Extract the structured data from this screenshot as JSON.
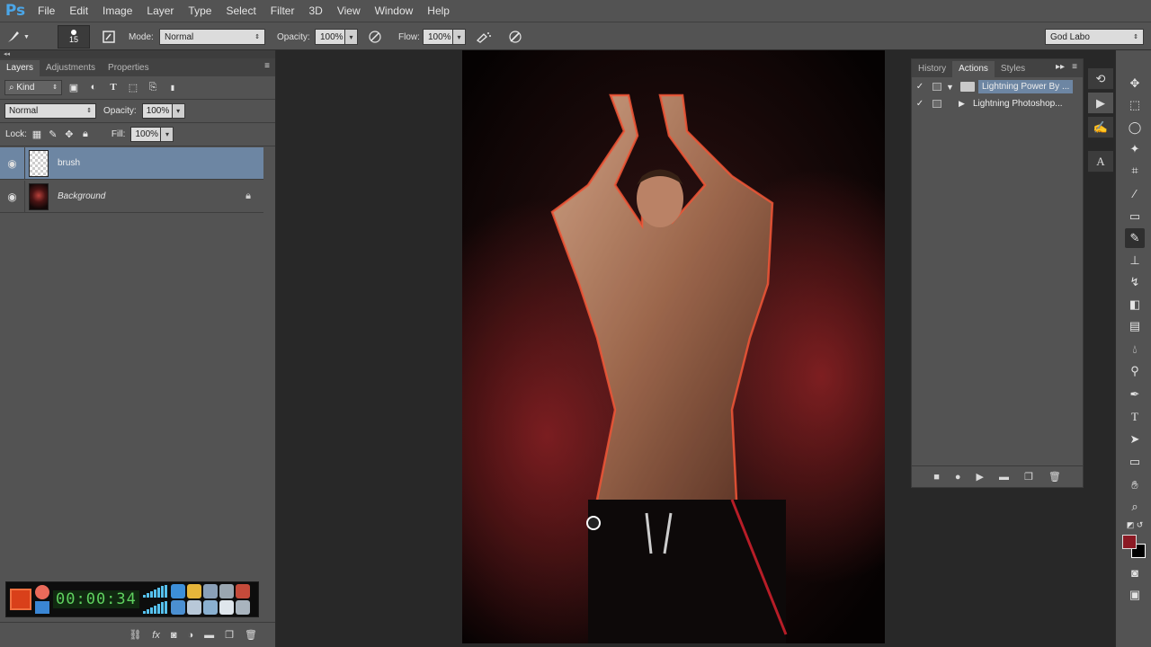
{
  "app": {
    "logo": "Ps",
    "menu": [
      "File",
      "Edit",
      "Image",
      "Layer",
      "Type",
      "Select",
      "Filter",
      "3D",
      "View",
      "Window",
      "Help"
    ]
  },
  "options_bar": {
    "brush_size": "15",
    "mode_label": "Mode:",
    "mode_value": "Normal",
    "opacity_label": "Opacity:",
    "opacity_value": "100%",
    "flow_label": "Flow:",
    "flow_value": "100%",
    "workspace": "God Labo"
  },
  "layers_panel": {
    "tabs": [
      "Layers",
      "Adjustments",
      "Properties"
    ],
    "filter_kind": "Kind",
    "blend_mode": "Normal",
    "opacity_label": "Opacity:",
    "opacity_value": "100%",
    "lock_label": "Lock:",
    "fill_label": "Fill:",
    "fill_value": "100%",
    "layers": [
      {
        "name": "brush",
        "selected": true
      },
      {
        "name": "Background",
        "locked": true
      }
    ]
  },
  "widget": {
    "timer": "00:00:34",
    "rec_color": "#d9401a"
  },
  "actions_panel": {
    "tabs": [
      "History",
      "Actions",
      "Styles"
    ],
    "items": [
      {
        "name": "Lightning Power By ...",
        "type": "set",
        "expanded": true,
        "selected": true
      },
      {
        "name": "Lightning Photoshop...",
        "type": "action",
        "expanded": false
      }
    ]
  },
  "colors": {
    "foreground": "#8b1a24",
    "background": "#000000",
    "selection": "#6d86a3",
    "panel": "#535353"
  }
}
